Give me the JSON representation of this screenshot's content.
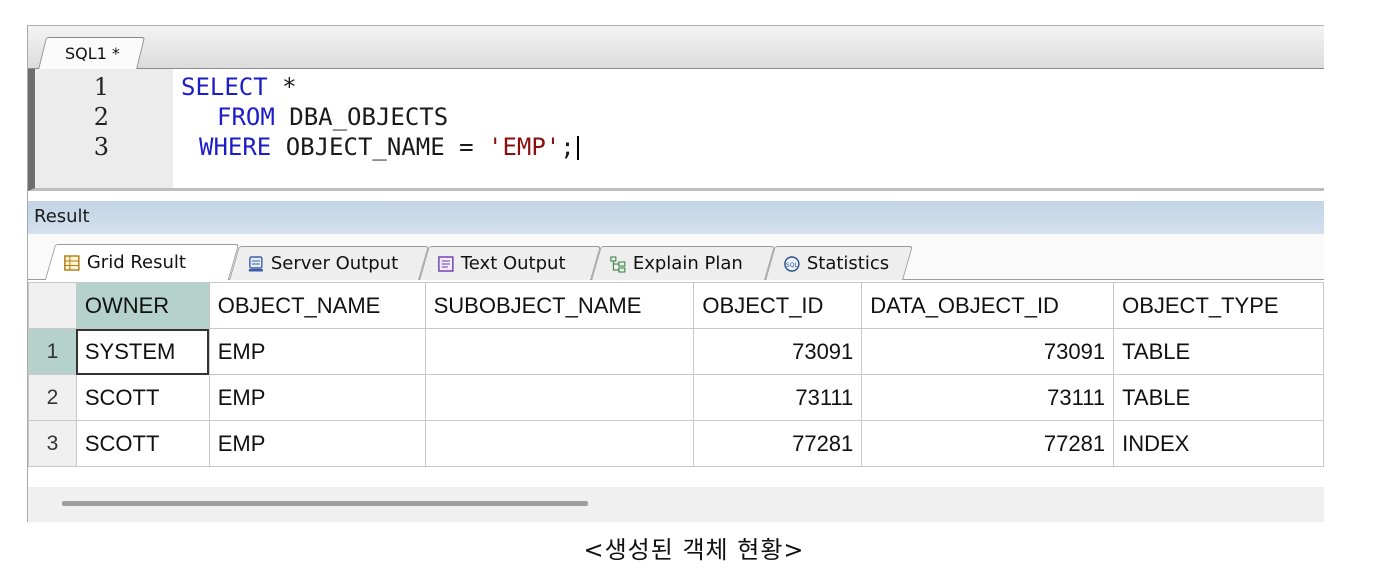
{
  "editor": {
    "tab_title": "SQL1 *",
    "lines": [
      {
        "number": "1",
        "tokens": [
          {
            "t": "SELECT",
            "c": "kw"
          },
          {
            "t": " *",
            "c": "pl"
          }
        ]
      },
      {
        "number": "2",
        "tokens": [
          {
            "t": "FROM",
            "c": "kw"
          },
          {
            "t": " DBA_OBJECTS",
            "c": "pl"
          }
        ]
      },
      {
        "number": "3",
        "tokens": [
          {
            "t": "WHERE",
            "c": "kw"
          },
          {
            "t": " OBJECT_NAME = ",
            "c": "pl"
          },
          {
            "t": "'EMP'",
            "c": "str"
          },
          {
            "t": ";",
            "c": "pl"
          }
        ]
      }
    ]
  },
  "result": {
    "title": "Result",
    "tabs": [
      {
        "label": "Grid Result",
        "icon": "grid-icon",
        "active": true
      },
      {
        "label": "Server Output",
        "icon": "server-output-icon",
        "active": false
      },
      {
        "label": "Text Output",
        "icon": "text-output-icon",
        "active": false
      },
      {
        "label": "Explain Plan",
        "icon": "explain-plan-icon",
        "active": false
      },
      {
        "label": "Statistics",
        "icon": "statistics-icon",
        "active": false
      }
    ],
    "columns": [
      "OWNER",
      "OBJECT_NAME",
      "SUBOBJECT_NAME",
      "OBJECT_ID",
      "DATA_OBJECT_ID",
      "OBJECT_TYPE"
    ],
    "rows": [
      {
        "n": "1",
        "cells": [
          "SYSTEM",
          "EMP",
          "",
          "73091",
          "73091",
          "TABLE"
        ]
      },
      {
        "n": "2",
        "cells": [
          "SCOTT",
          "EMP",
          "",
          "73111",
          "73111",
          "TABLE"
        ]
      },
      {
        "n": "3",
        "cells": [
          "SCOTT",
          "EMP",
          "",
          "77281",
          "77281",
          "INDEX"
        ]
      }
    ]
  },
  "caption": "<생성된 객체 현황>",
  "colors": {
    "keyword": "#1d1dc8",
    "string": "#8b0f0f",
    "selected": "#b5d1cb",
    "result_header": "#c9d9ea"
  }
}
